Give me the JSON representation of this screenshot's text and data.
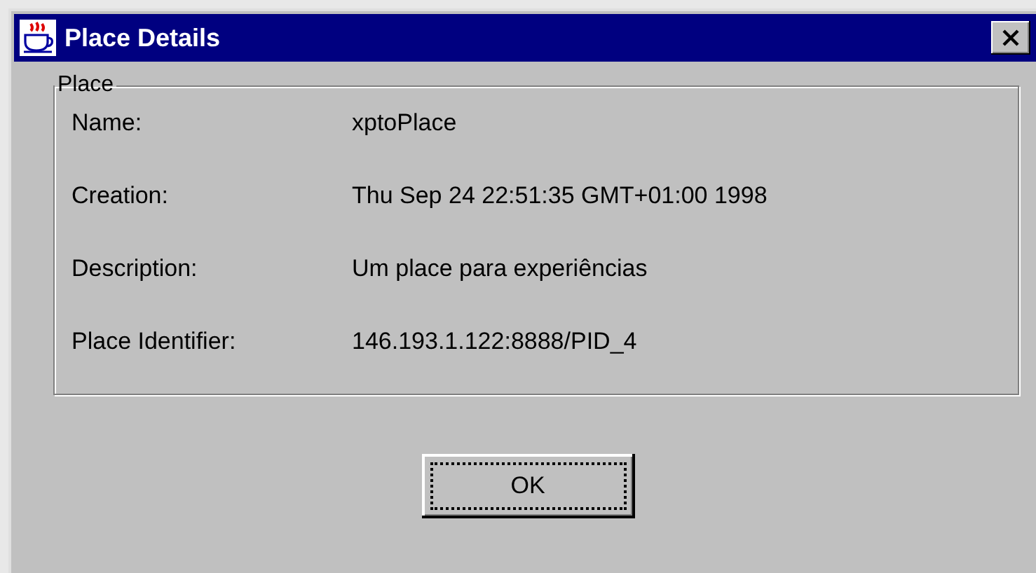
{
  "window": {
    "title": "Place Details"
  },
  "group": {
    "title": "Place",
    "fields": [
      {
        "label": "Name:",
        "value": "xptoPlace"
      },
      {
        "label": "Creation:",
        "value": "Thu Sep 24 22:51:35 GMT+01:00 1998"
      },
      {
        "label": "Description:",
        "value": "Um place para experiências"
      },
      {
        "label": "Place Identifier:",
        "value": "146.193.1.122:8888/PID_4"
      }
    ]
  },
  "buttons": [
    {
      "label": "OK",
      "focused": true
    }
  ]
}
